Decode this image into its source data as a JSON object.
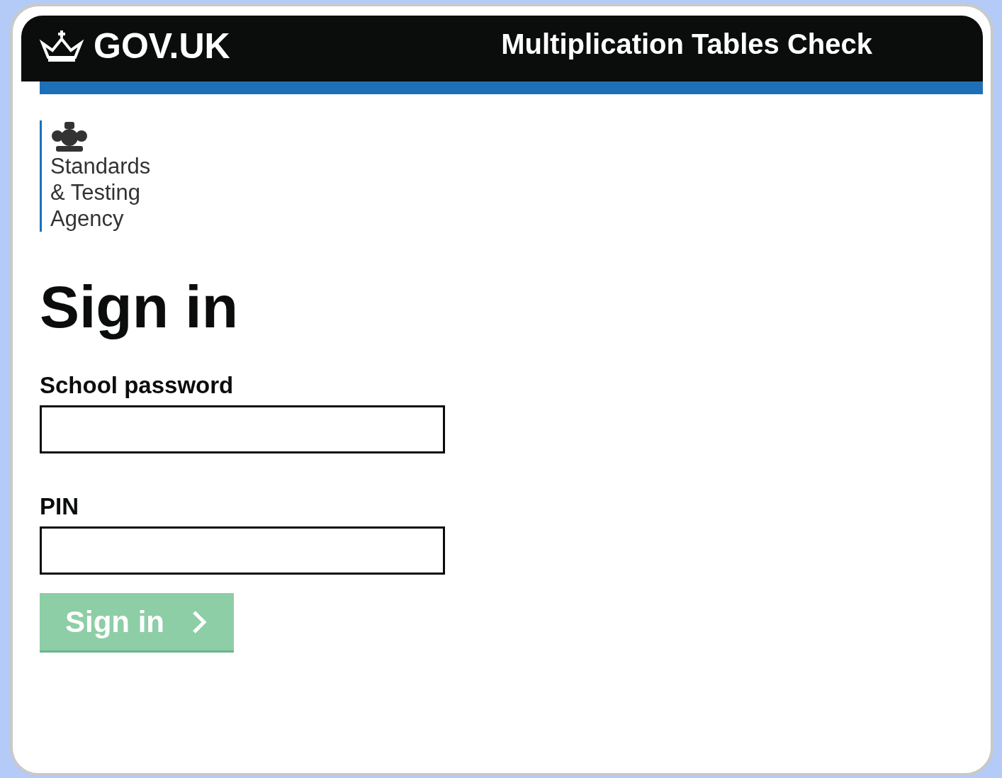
{
  "header": {
    "logo_text": "GOV.UK",
    "service_name": "Multiplication Tables Check"
  },
  "organisation": {
    "lines": [
      "Standards",
      "& Testing",
      "Agency"
    ]
  },
  "heading": "Sign in",
  "fields": [
    {
      "label": "School password"
    },
    {
      "label": "PIN"
    }
  ],
  "button": {
    "label": "Sign in",
    "disabled": true
  }
}
